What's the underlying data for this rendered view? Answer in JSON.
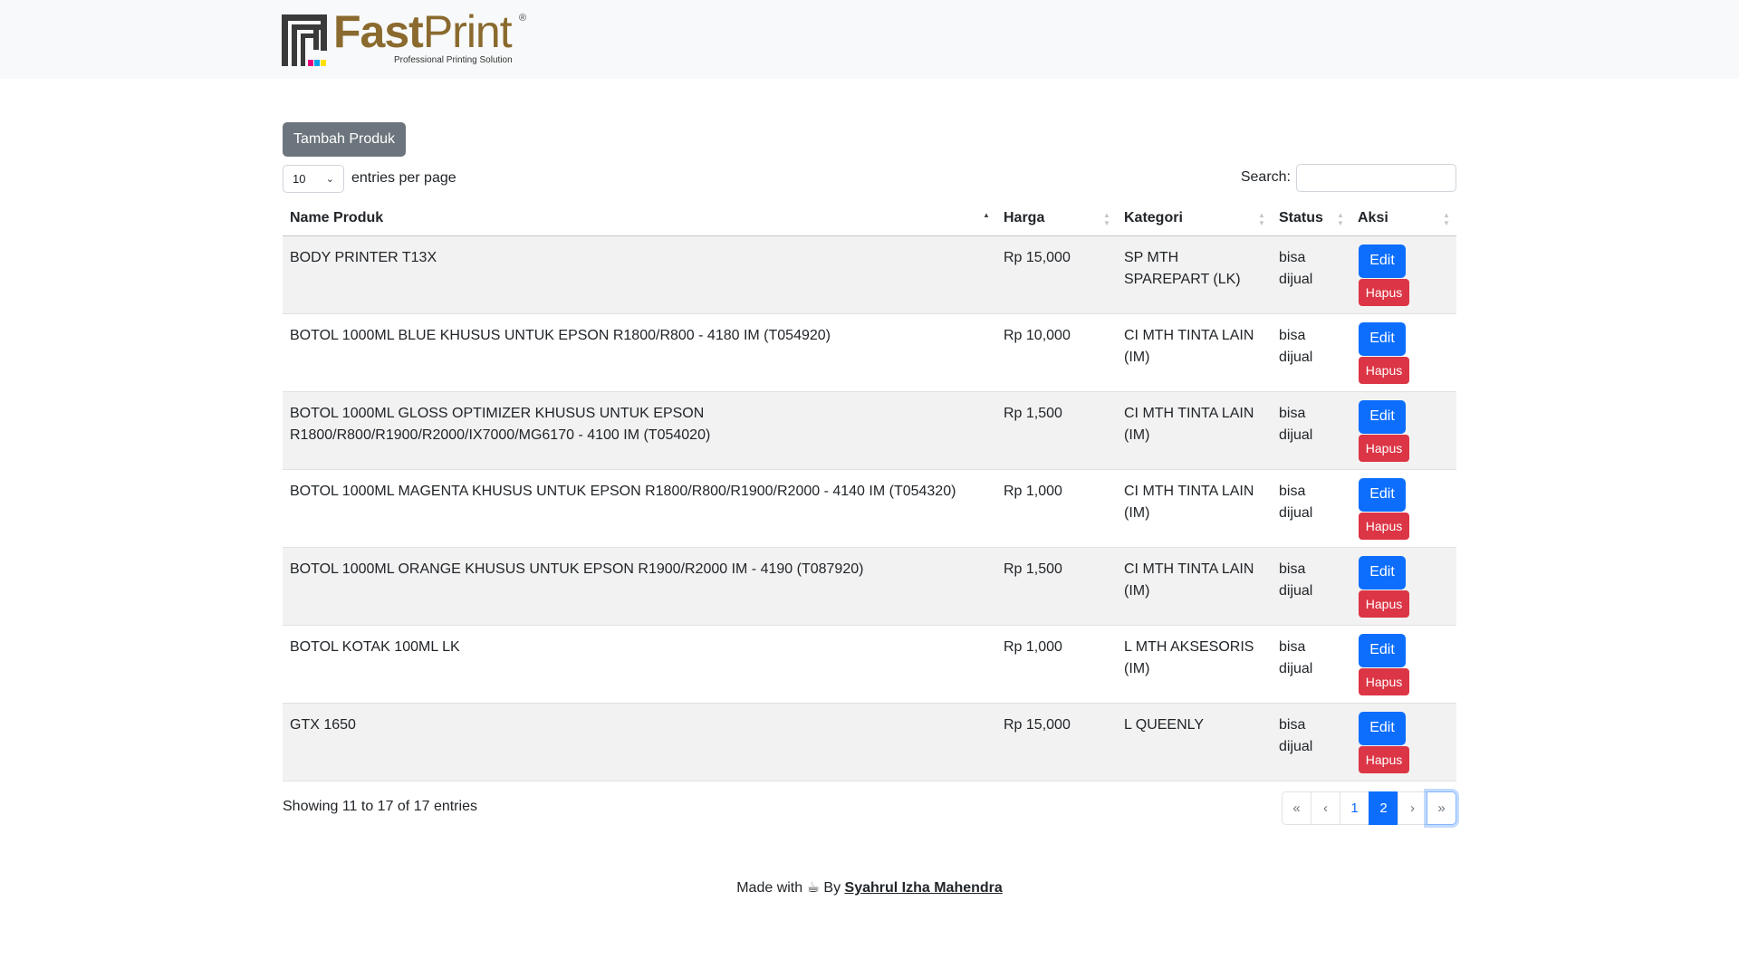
{
  "brand": {
    "name_part1": "Fast",
    "name_part2": "Print",
    "registered": "®",
    "tagline": "Professional Printing Solution",
    "accent_color": "#8a6a2e"
  },
  "toolbar": {
    "add_label": "Tambah Produk",
    "length_value": "10",
    "length_suffix": "entries per page",
    "search_label": "Search:",
    "search_value": ""
  },
  "table": {
    "columns": [
      "Name Produk",
      "Harga",
      "Kategori",
      "Status",
      "Aksi"
    ],
    "rows": [
      {
        "name": "BODY PRINTER T13X",
        "harga": "Rp 15,000",
        "kategori": "SP MTH SPAREPART (LK)",
        "status": "bisa dijual"
      },
      {
        "name": "BOTOL 1000ML BLUE KHUSUS UNTUK EPSON R1800/R800 - 4180 IM (T054920)",
        "harga": "Rp 10,000",
        "kategori": "CI MTH TINTA LAIN (IM)",
        "status": "bisa dijual"
      },
      {
        "name": "BOTOL 1000ML GLOSS OPTIMIZER KHUSUS UNTUK EPSON R1800/R800/R1900/R2000/IX7000/MG6170 - 4100 IM (T054020)",
        "harga": "Rp 1,500",
        "kategori": "CI MTH TINTA LAIN (IM)",
        "status": "bisa dijual"
      },
      {
        "name": "BOTOL 1000ML MAGENTA KHUSUS UNTUK EPSON R1800/R800/R1900/R2000 - 4140 IM (T054320)",
        "harga": "Rp 1,000",
        "kategori": "CI MTH TINTA LAIN (IM)",
        "status": "bisa dijual"
      },
      {
        "name": "BOTOL 1000ML ORANGE KHUSUS UNTUK EPSON R1900/R2000 IM - 4190 (T087920)",
        "harga": "Rp 1,500",
        "kategori": "CI MTH TINTA LAIN (IM)",
        "status": "bisa dijual"
      },
      {
        "name": "BOTOL KOTAK 100ML LK",
        "harga": "Rp 1,000",
        "kategori": "L MTH AKSESORIS (IM)",
        "status": "bisa dijual"
      },
      {
        "name": "GTX 1650",
        "harga": "Rp 15,000",
        "kategori": "L QUEENLY",
        "status": "bisa dijual"
      }
    ],
    "edit_label": "Edit",
    "delete_label": "Hapus"
  },
  "info": "Showing 11 to 17 of 17 entries",
  "pagination": {
    "first": "«",
    "prev": "‹",
    "pages": [
      "1",
      "2"
    ],
    "active_page": "2",
    "next": "›",
    "last": "»"
  },
  "footer": {
    "made_with": "Made with",
    "by": "By",
    "author": "Syahrul Izha Mahendra"
  },
  "colors": {
    "primary": "#0d6efd",
    "danger": "#dc3545",
    "secondary": "#6c757d",
    "topbar": "#f8f9fa"
  },
  "icons": {
    "cup": "coffee-cup-icon"
  }
}
